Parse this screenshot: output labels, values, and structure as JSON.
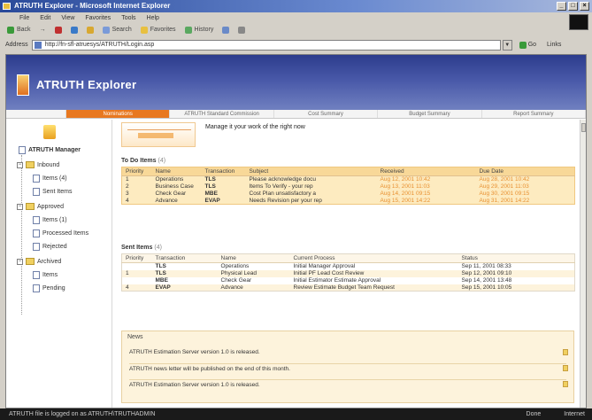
{
  "window": {
    "title": "ATRUTH Explorer - Microsoft Internet Explorer",
    "btn_min": "_",
    "btn_max": "□",
    "btn_close": "×"
  },
  "menu": [
    "File",
    "Edit",
    "View",
    "Favorites",
    "Tools",
    "Help"
  ],
  "toolbar": {
    "back": "Back",
    "forward": "→",
    "search": "Search",
    "favorites": "Favorites",
    "history": "History"
  },
  "address": {
    "label": "Address",
    "value": "http://fn-sfl-atruesys/ATRUTH/Login.asp",
    "go": "Go",
    "links": "Links"
  },
  "app": {
    "title": "ATRUTH Explorer",
    "nav_tabs": [
      "",
      "Nominations",
      "ATRUTH Standard Commission",
      "Cost Summary",
      "Budget Summary",
      "Report Summary"
    ],
    "active_tab": 1
  },
  "tree": {
    "root": "ATRUTH Manager",
    "items": [
      {
        "label": "Inbound",
        "level": 1,
        "type": "folder",
        "expand": "−"
      },
      {
        "label": "Items (4)",
        "level": 2,
        "type": "doc"
      },
      {
        "label": "Sent Items",
        "level": 2,
        "type": "doc"
      },
      {
        "label": "Approved",
        "level": 1,
        "type": "folder",
        "expand": "−"
      },
      {
        "label": "Items (1)",
        "level": 2,
        "type": "doc"
      },
      {
        "label": "Processed Items",
        "level": 2,
        "type": "doc"
      },
      {
        "label": "Rejected",
        "level": 2,
        "type": "doc"
      },
      {
        "label": "Archived",
        "level": 1,
        "type": "folder",
        "expand": "−"
      },
      {
        "label": "Items",
        "level": 2,
        "type": "doc"
      },
      {
        "label": "Pending",
        "level": 2,
        "type": "doc"
      }
    ]
  },
  "main": {
    "welcome": "Manage it your work of the right now",
    "todo": {
      "title": "To Do Items",
      "count": "(4)",
      "headers": [
        "Priority",
        "Name",
        "Transaction",
        "Subject",
        "Received",
        "Due Date"
      ],
      "rows": [
        [
          "1",
          "Operations",
          "TLS",
          "Please acknowledge docu",
          "Aug 12, 2001 10:42",
          "Aug 28, 2001 10:42"
        ],
        [
          "2",
          "Business Case",
          "TLS",
          "Items To Verify - your rep",
          "Aug 13, 2001 11:03",
          "Aug 29, 2001 11:03"
        ],
        [
          "3",
          "Check Gear",
          "MBE",
          "Cost Plan unsatisfactory a",
          "Aug 14, 2001 09:15",
          "Aug 30, 2001 09:15"
        ],
        [
          "4",
          "Advance",
          "EVAP",
          "Needs Revision per your rep",
          "Aug 15, 2001 14:22",
          "Aug 31, 2001 14:22"
        ]
      ]
    },
    "sent": {
      "title": "Sent Items",
      "count": "(4)",
      "headers": [
        "Priority",
        "Transaction",
        "Name",
        "Current Process",
        "Status"
      ],
      "rows": [
        [
          "",
          "TLS",
          "Operations",
          "Initial Manager Approval",
          "Sep 11, 2001 08:33"
        ],
        [
          "1",
          "TLS",
          "Physical Lead",
          "Initial PF Lead Cost Review",
          "Sep 12, 2001 09:10"
        ],
        [
          "",
          "MBE",
          "Check Gear",
          "Initial Estimator Estimate Approval",
          "Sep 14, 2001 13:48"
        ],
        [
          "4",
          "EVAP",
          "Advance",
          "Review Estimate Budget Team Request",
          "Sep 15, 2001 10:05"
        ]
      ]
    },
    "news": {
      "title": "News",
      "items": [
        "ATRUTH Estimation Server version 1.0 is released.",
        "ATRUTH news letter will be published on the end of this month.",
        "ATRUTH Estimation Server version 1.0 is released."
      ]
    }
  },
  "status": {
    "left": "ATRUTH file is logged on as ATRUTH\\TRUTHADMIN",
    "zone": "Done",
    "zone2": "Internet"
  }
}
